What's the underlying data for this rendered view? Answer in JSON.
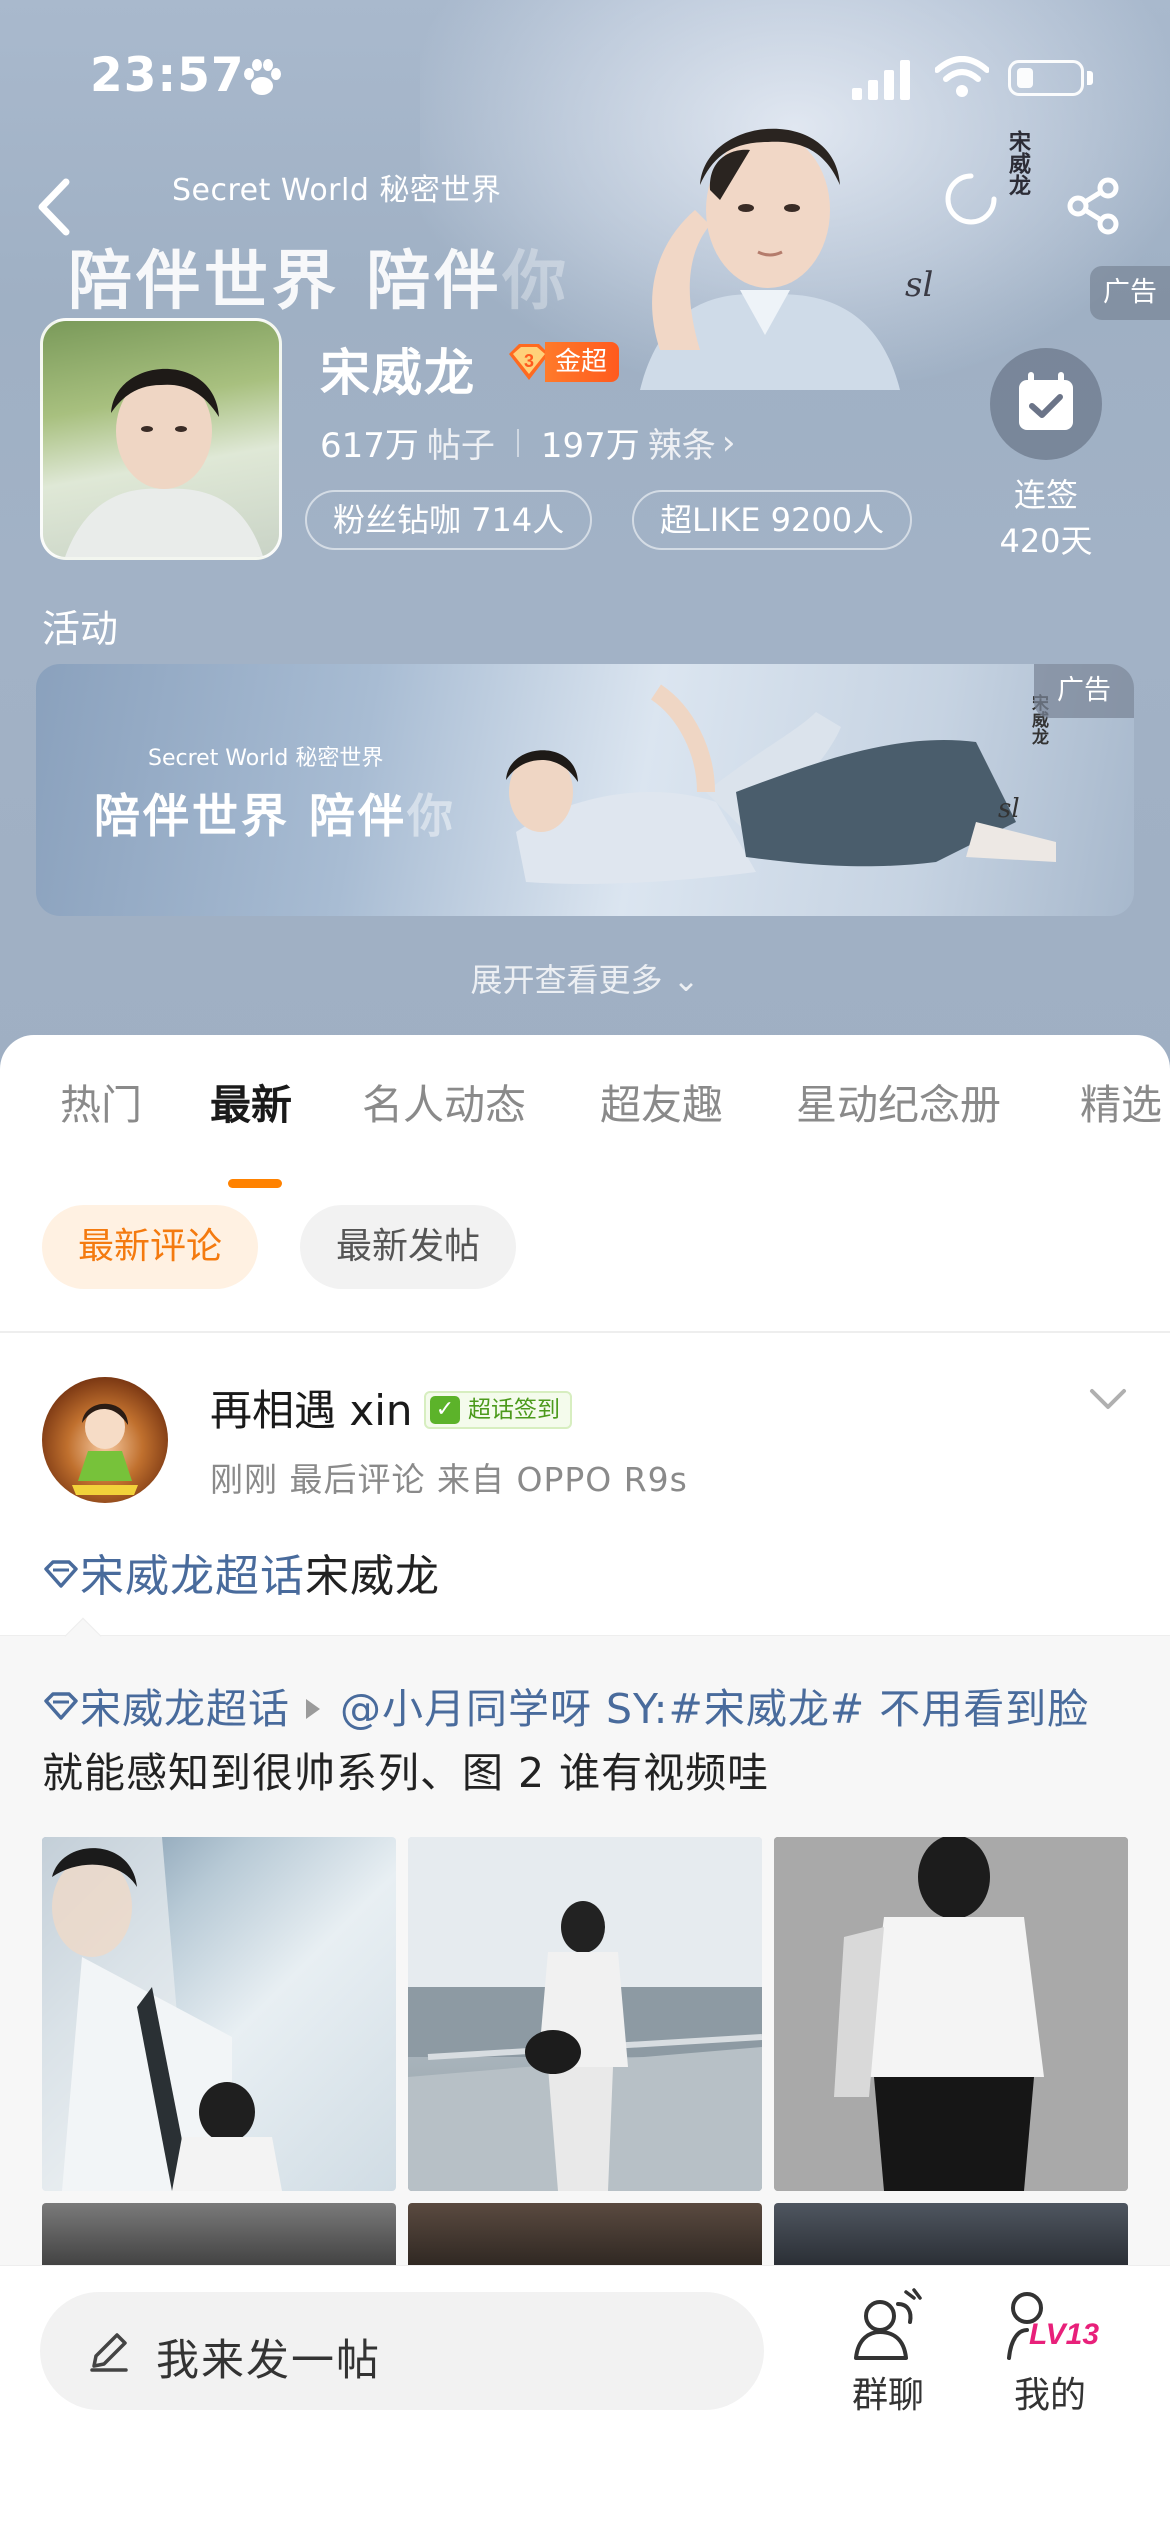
{
  "status_bar": {
    "time": "23:57"
  },
  "header": {
    "brand_line": "Secret World 秘密世界",
    "slogan_a": "陪伴世界 陪伴",
    "slogan_b": "你",
    "ad_label": "广告",
    "signature_text": "宋威龙",
    "name": "宋威龙",
    "badge": {
      "level": "3",
      "label": "金超"
    },
    "stats": {
      "posts_value": "617万",
      "posts_label": "帖子",
      "spicy_value": "197万",
      "spicy_label": "辣条",
      "spicy_chevron": "›"
    },
    "pills": [
      "粉丝钻咖 714人",
      "超LIKE 9200人"
    ],
    "checkin": {
      "label": "连签",
      "days": "420天"
    }
  },
  "activity": {
    "title": "活动",
    "banner": {
      "brand_line": "Secret World 秘密世界",
      "slogan_a": "陪伴世界 陪伴",
      "slogan_b": "你",
      "ad_label": "广告"
    },
    "expand_label": "展开查看更多 ⌄"
  },
  "tabs": [
    {
      "label": "热门",
      "active": false
    },
    {
      "label": "最新",
      "active": true
    },
    {
      "label": "名人动态",
      "active": false
    },
    {
      "label": "超友趣",
      "active": false
    },
    {
      "label": "星动纪念册",
      "active": false
    },
    {
      "label": "精选",
      "active": false
    }
  ],
  "filters": {
    "selected": "最新评论",
    "other": "最新发帖"
  },
  "post": {
    "username": "再相遇 xin",
    "sign_badge": "超话签到",
    "meta": "刚刚 最后评论 来自 OPPO R9s",
    "body_topic": "宋威龙超话",
    "body_text": "宋威龙",
    "quote": {
      "topic": "宋威龙超话",
      "line1_rest": "@小月同学呀 SY:#宋威龙# 不用看到脸",
      "line2": "就能感知到很帅系列、图 2 谁有视频哇"
    }
  },
  "bottom_bar": {
    "compose_placeholder": "我来发一帖",
    "nav_group": "群聊",
    "nav_me": "我的",
    "level_badge": "LV13"
  },
  "colors": {
    "accent": "#ff8200",
    "topic_blue": "#496b9c",
    "badge_orange": "#ff5a1e",
    "sign_green": "#5cb32a"
  },
  "icons": [
    "paw-icon",
    "signal-icon",
    "wifi-icon",
    "battery-icon",
    "back-arrow-icon",
    "loading-ring-icon",
    "share-icon",
    "checkin-calendar-icon",
    "diamond-topic-icon",
    "chevron-down-icon",
    "pen-icon",
    "group-chat-icon",
    "profile-icon"
  ]
}
